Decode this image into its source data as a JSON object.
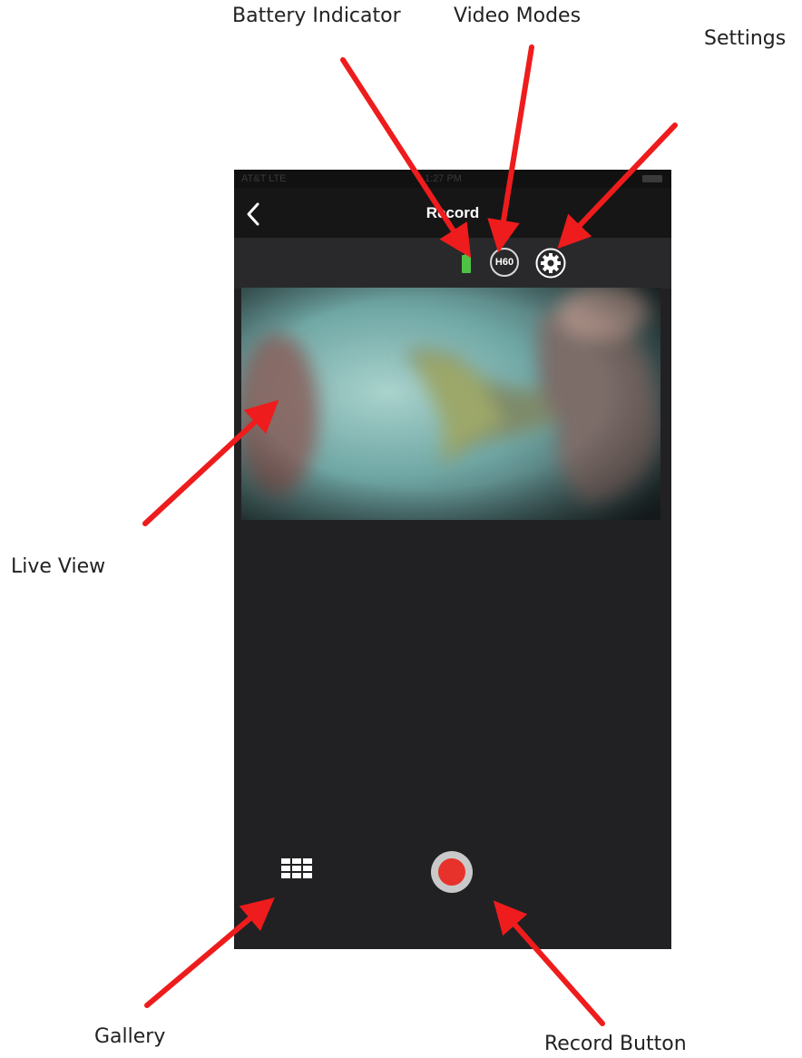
{
  "annotations": {
    "battery_indicator": "Battery Indicator",
    "video_modes": "Video Modes",
    "settings": "Settings",
    "live_view": "Live View",
    "gallery": "Gallery",
    "record_button": "Record Button"
  },
  "status_bar": {
    "carrier": "AT&T  LTE",
    "time": "1:27 PM"
  },
  "nav": {
    "back_label": "<",
    "title": "Record"
  },
  "toolbar": {
    "battery_icon": "battery-icon",
    "battery_level": 1.0,
    "video_mode_label": "H60",
    "settings_icon": "gear-icon"
  },
  "bottom": {
    "gallery_icon": "grid-icon",
    "record_icon": "record-icon"
  },
  "colors": {
    "arrow": "#ee1c1c",
    "app_background": "#212123",
    "battery": "#4fc144",
    "record": "#e7322b"
  }
}
